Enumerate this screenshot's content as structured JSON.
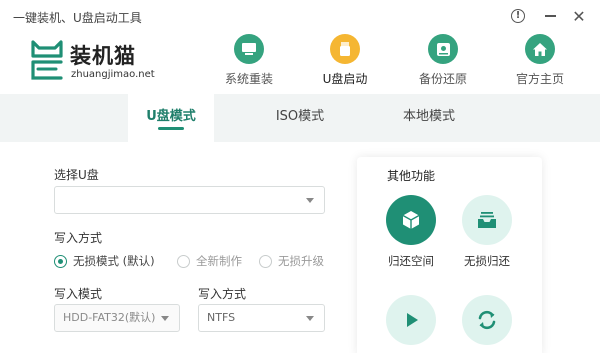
{
  "window": {
    "title": "一键装机、U盘启动工具",
    "help_icon": "question-circle-icon",
    "minimize_icon": "minimize-icon",
    "close_icon": "close-icon"
  },
  "logo": {
    "name": "装机猫",
    "url": "zhuangjimao.net",
    "icon": "cat-logo-icon"
  },
  "nav": {
    "items": [
      {
        "label": "系统重装",
        "icon": "monitor-icon",
        "active": false
      },
      {
        "label": "U盘启动",
        "icon": "usb-drive-icon",
        "active": true
      },
      {
        "label": "备份还原",
        "icon": "disk-backup-icon",
        "active": false
      },
      {
        "label": "官方主页",
        "icon": "home-icon",
        "active": false
      }
    ]
  },
  "tabs": {
    "items": [
      {
        "label": "U盘模式",
        "active": true
      },
      {
        "label": "ISO模式",
        "active": false
      },
      {
        "label": "本地模式",
        "active": false
      }
    ]
  },
  "form": {
    "usb_label": "选择U盘",
    "usb_value": "",
    "write_method_label": "写入方式",
    "write_methods": [
      {
        "label": "无损模式 (默认)",
        "checked": true
      },
      {
        "label": "全新制作",
        "checked": false
      },
      {
        "label": "无损升级",
        "checked": false
      }
    ],
    "write_mode_label": "写入模式",
    "write_mode_value": "HDD-FAT32(默认)",
    "fs_label": "写入方式",
    "fs_value": "NTFS"
  },
  "panel": {
    "title": "其他功能",
    "functions": [
      {
        "label": "归还空间",
        "icon": "cube-icon"
      },
      {
        "label": "无损归还",
        "icon": "tray-restore-icon"
      },
      {
        "label": "",
        "icon": "play-icon"
      },
      {
        "label": "",
        "icon": "refresh-icon"
      }
    ]
  },
  "colors": {
    "accent": "#1f8f75",
    "nav_icon_bg": "#35a37f",
    "nav_active_icon_bg": "#f5b632",
    "tab_strip_bg": "#f1f4f4",
    "func_light_bg": "#dff3ee"
  }
}
